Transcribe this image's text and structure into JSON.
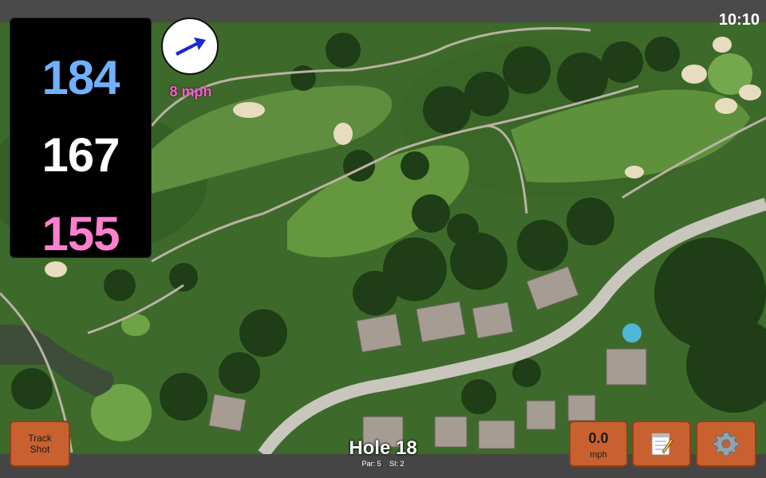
{
  "status": {
    "time": "10:10"
  },
  "distances": {
    "back": "184",
    "middle": "167",
    "front": "155"
  },
  "wind": {
    "speed_text": "8 mph",
    "arrow_icon": "wind-arrow-icon"
  },
  "hole": {
    "title": "Hole 18",
    "par_label": "Par: 5",
    "si_label": "SI: 2"
  },
  "buttons": {
    "track_shot": {
      "line1": "Track",
      "line2": "Shot"
    },
    "wind_display": {
      "value": "0.0",
      "unit": "mph"
    },
    "notes_icon": "notepad-icon",
    "settings_icon": "gear-icon"
  },
  "colors": {
    "accent_button": "#c8612f",
    "back_distance": "#6fb1ff",
    "middle_distance": "#ffffff",
    "front_distance": "#ff7fcf",
    "wind_text": "#ff5ad2"
  }
}
